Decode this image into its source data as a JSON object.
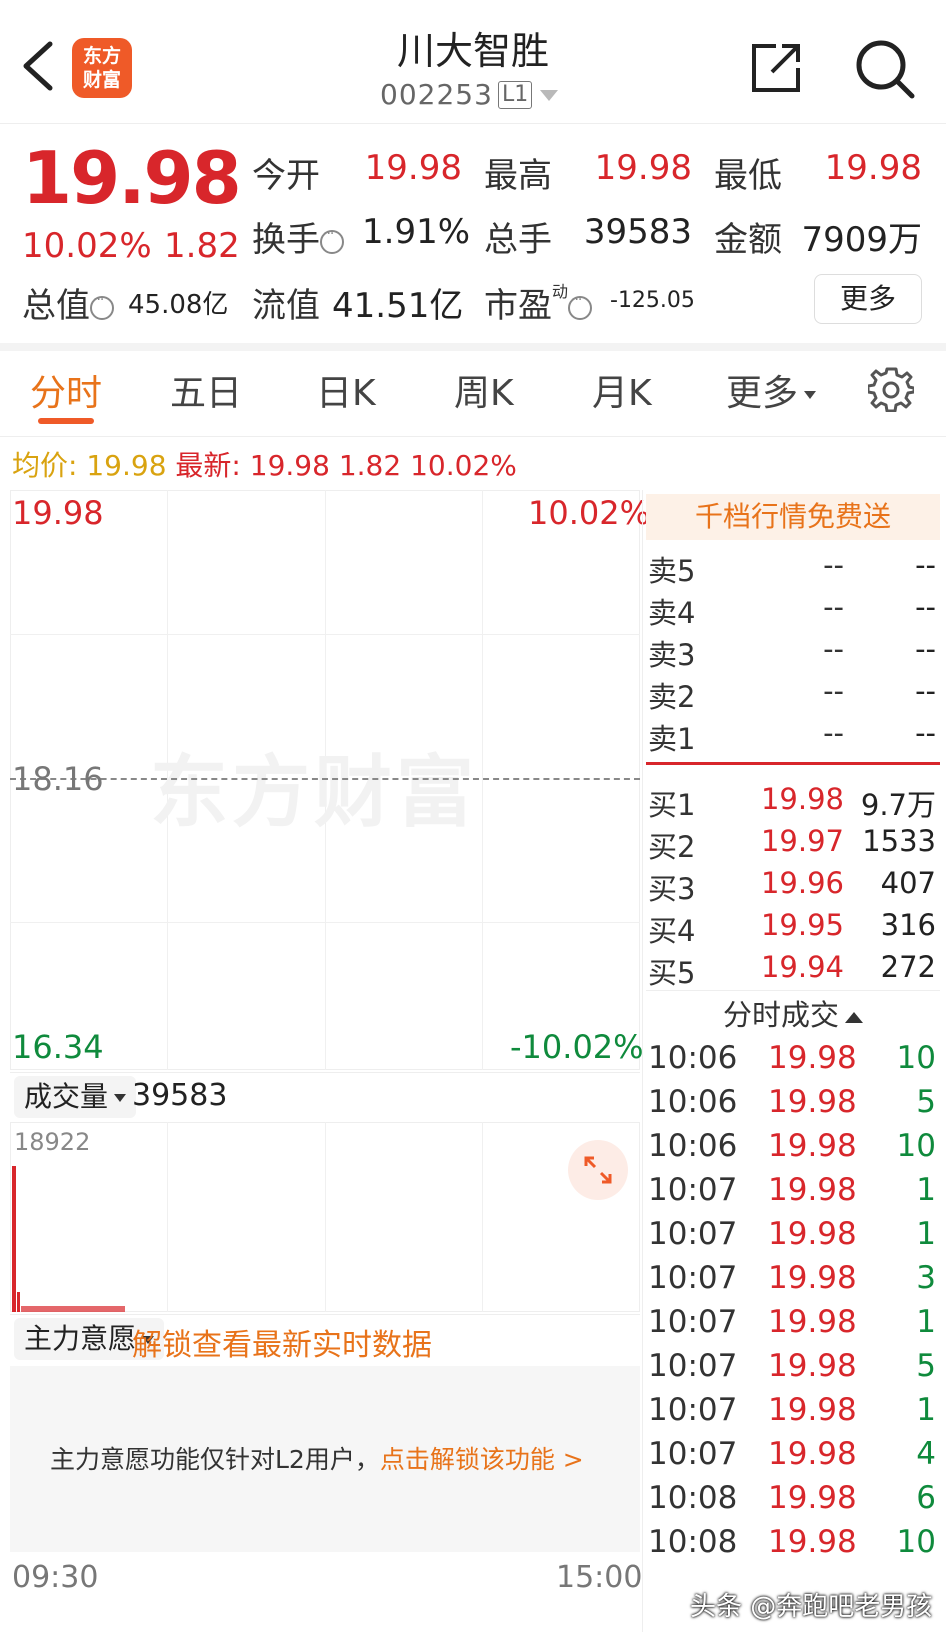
{
  "header": {
    "logo_line1": "东方",
    "logo_line2": "财富",
    "title": "川大智胜",
    "code": "002253",
    "level": "L1"
  },
  "quote": {
    "price": "19.98",
    "change_pct": "10.02%",
    "change": "1.82",
    "open_label": "今开",
    "open": "19.98",
    "high_label": "最高",
    "high": "19.98",
    "low_label": "最低",
    "low": "19.98",
    "turnover_label": "换手",
    "turnover": "1.91%",
    "volume_label": "总手",
    "volume": "39583",
    "amount_label": "金额",
    "amount": "7909万",
    "mktcap_label": "总值",
    "mktcap": "45.08亿",
    "float_label": "流值",
    "float": "41.51亿",
    "pe_label": "市盈",
    "pe_sup": "动",
    "pe": "-125.05",
    "more": "更多"
  },
  "tabs": [
    "分时",
    "五日",
    "日K",
    "周K",
    "月K",
    "更多"
  ],
  "avgline": {
    "avg_label": "均价:",
    "avg": "19.98",
    "latest_label": "最新:",
    "latest": "19.98",
    "chg": "1.82",
    "pct": "10.02%"
  },
  "chart": {
    "top_price": "19.98",
    "top_pct": "10.02%",
    "mid_price": "18.16",
    "bottom_price": "16.34",
    "bottom_pct": "-10.02%",
    "watermark": "东方财富",
    "volume_label": "成交量",
    "volume_total": "39583",
    "volume_max": "18922",
    "zl_label": "主力意愿",
    "zl_unlock": "解锁查看最新实时数据",
    "zl_msg": "主力意愿功能仅针对L2用户，",
    "zl_link": "点击解锁该功能 >",
    "time_start": "09:30",
    "time_end": "15:00"
  },
  "orderbook": {
    "promo": "千档行情免费送",
    "asks": [
      {
        "label": "卖5",
        "price": "--",
        "vol": "--"
      },
      {
        "label": "卖4",
        "price": "--",
        "vol": "--"
      },
      {
        "label": "卖3",
        "price": "--",
        "vol": "--"
      },
      {
        "label": "卖2",
        "price": "--",
        "vol": "--"
      },
      {
        "label": "卖1",
        "price": "--",
        "vol": "--"
      }
    ],
    "bids": [
      {
        "label": "买1",
        "price": "19.98",
        "vol": "9.7万"
      },
      {
        "label": "买2",
        "price": "19.97",
        "vol": "1533"
      },
      {
        "label": "买3",
        "price": "19.96",
        "vol": "407"
      },
      {
        "label": "买4",
        "price": "19.95",
        "vol": "316"
      },
      {
        "label": "买5",
        "price": "19.94",
        "vol": "272"
      }
    ]
  },
  "ticks": {
    "heading": "分时成交",
    "rows": [
      {
        "time": "10:06",
        "price": "19.98",
        "vol": "10"
      },
      {
        "time": "10:06",
        "price": "19.98",
        "vol": "5"
      },
      {
        "time": "10:06",
        "price": "19.98",
        "vol": "10"
      },
      {
        "time": "10:07",
        "price": "19.98",
        "vol": "1"
      },
      {
        "time": "10:07",
        "price": "19.98",
        "vol": "1"
      },
      {
        "time": "10:07",
        "price": "19.98",
        "vol": "3"
      },
      {
        "time": "10:07",
        "price": "19.98",
        "vol": "1"
      },
      {
        "time": "10:07",
        "price": "19.98",
        "vol": "5"
      },
      {
        "time": "10:07",
        "price": "19.98",
        "vol": "1"
      },
      {
        "time": "10:07",
        "price": "19.98",
        "vol": "4"
      },
      {
        "time": "10:08",
        "price": "19.98",
        "vol": "6"
      },
      {
        "time": "10:08",
        "price": "19.98",
        "vol": "10"
      }
    ]
  },
  "footer_watermark": "头条 @奔跑吧老男孩",
  "colors": {
    "up": "#d8262b",
    "down": "#0f8a3c",
    "accent": "#ef5a28",
    "avg": "#d9a310"
  }
}
